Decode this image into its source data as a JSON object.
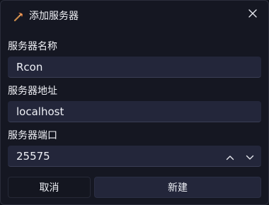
{
  "dialog": {
    "title": "添加服务器",
    "icon": "pick-icon",
    "close_icon": "close-icon"
  },
  "fields": {
    "name_label": "服务器名称",
    "name_value": "Rcon",
    "address_label": "服务器地址",
    "address_value": "localhost",
    "port_label": "服务器端口",
    "port_value": "25575"
  },
  "buttons": {
    "cancel": "取消",
    "create": "新建"
  },
  "colors": {
    "background": "#151722",
    "field": "#23263a",
    "accent_icon": "#e07a3a"
  }
}
